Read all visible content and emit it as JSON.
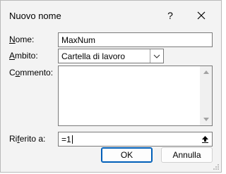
{
  "dialog": {
    "title": "Nuovo nome",
    "help_label": "?"
  },
  "fields": {
    "name_label_accel": "N",
    "name_label_rest": "ome:",
    "name_value": "MaxNum",
    "scope_label_accel": "A",
    "scope_label_rest": "mbito:",
    "scope_value": "Cartella di lavoro",
    "comment_label_pre": "C",
    "comment_label_accel": "o",
    "comment_label_rest": "mmento:",
    "comment_value": "",
    "refers_label_pre": "Ri",
    "refers_label_accel": "f",
    "refers_label_rest": "erito a:",
    "refers_value": "=1"
  },
  "buttons": {
    "ok": "OK",
    "cancel": "Annulla"
  },
  "colors": {
    "accent": "#005fb8",
    "background": "#f3f3f3"
  }
}
